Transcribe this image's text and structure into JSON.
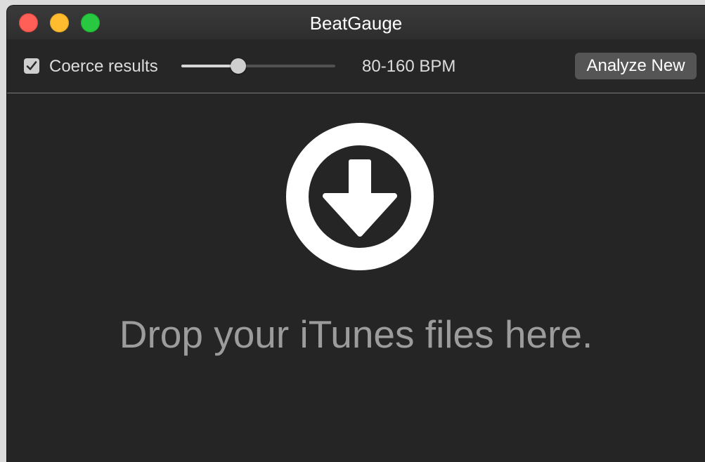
{
  "window": {
    "title": "BeatGauge",
    "controls": [
      "close",
      "minimize",
      "zoom"
    ]
  },
  "toolbar": {
    "coerce_checkbox": {
      "label": "Coerce results",
      "checked": true
    },
    "bpm_slider": {
      "level": 0.37
    },
    "bpm_range_label": "80-160 BPM",
    "analyze_button_label": "Analyze New"
  },
  "drop_zone": {
    "icon": "download-arrow-circle-icon",
    "message": "Drop your iTunes files here."
  },
  "colors": {
    "background": "#252525",
    "title_text": "#ffffff",
    "drop_text": "#9c9c9c",
    "button": "#555555",
    "close": "#ff5f57",
    "minimize": "#febc2e",
    "zoom": "#28c840"
  }
}
